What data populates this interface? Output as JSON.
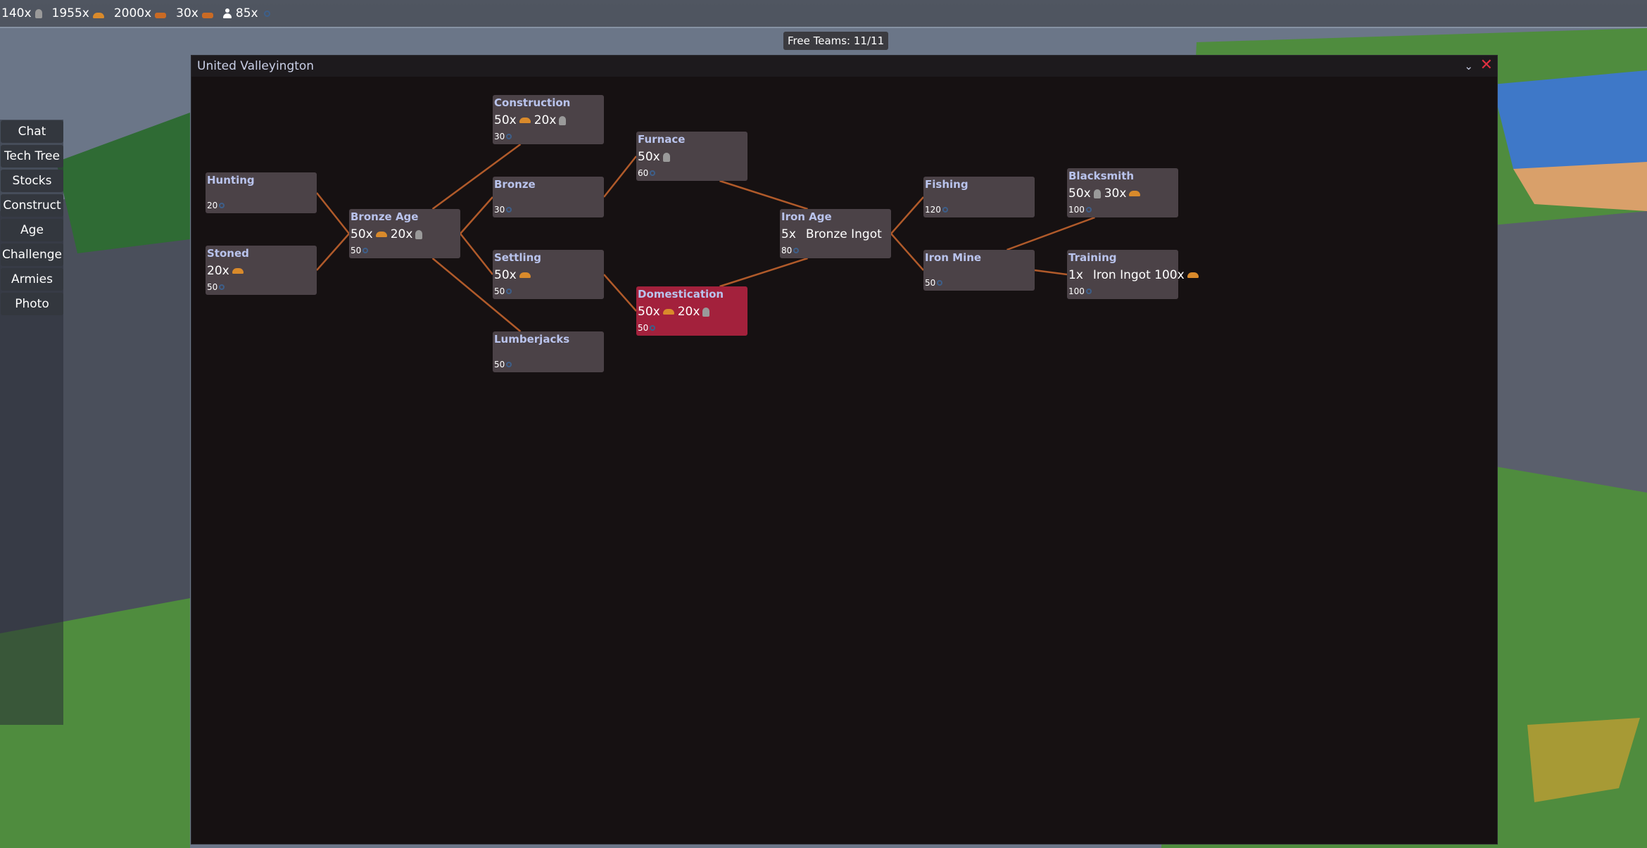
{
  "hud": {
    "resources": [
      {
        "amount": "140x",
        "icon": "stone-icon"
      },
      {
        "amount": "1955x",
        "icon": "food-icon"
      },
      {
        "amount": "2000x",
        "icon": "wood-icon"
      },
      {
        "amount": "30x",
        "icon": "wood-icon"
      },
      {
        "amount": "85x",
        "icon": "person-icon",
        "prefix_icon": true
      },
      {
        "amount": "",
        "icon": "gear-icon"
      }
    ],
    "free_teams": "Free Teams: 11/11"
  },
  "menu": {
    "items": [
      "Chat",
      "Tech Tree",
      "Stocks",
      "Construct",
      "Age",
      "Challenge",
      "Armies",
      "Photo"
    ]
  },
  "window": {
    "title": "United Valleyington",
    "minimize_icon": "chevron-down-icon",
    "close_icon": "close-icon"
  },
  "tech_tree": {
    "nodes": [
      {
        "id": "hunting",
        "name": "Hunting",
        "cost": [],
        "xp": "20"
      },
      {
        "id": "stoned",
        "name": "Stoned",
        "cost": [
          {
            "amount": "20x",
            "icon": "food-icon"
          }
        ],
        "xp": "50"
      },
      {
        "id": "bronze-age",
        "name": "Bronze Age",
        "cost": [
          {
            "amount": "50x",
            "icon": "food-icon"
          },
          {
            "amount": "20x",
            "icon": "stone-icon"
          }
        ],
        "xp": "50"
      },
      {
        "id": "construction",
        "name": "Construction",
        "cost": [
          {
            "amount": "50x",
            "icon": "food-icon"
          },
          {
            "amount": "20x",
            "icon": "stone-icon"
          }
        ],
        "xp": "30"
      },
      {
        "id": "bronze",
        "name": "Bronze",
        "cost": [],
        "xp": "30"
      },
      {
        "id": "settling",
        "name": "Settling",
        "cost": [
          {
            "amount": "50x",
            "icon": "food-icon"
          }
        ],
        "xp": "50"
      },
      {
        "id": "lumberjacks",
        "name": "Lumberjacks",
        "cost": [],
        "xp": "50"
      },
      {
        "id": "furnace",
        "name": "Furnace",
        "cost": [
          {
            "amount": "50x",
            "icon": "stone-icon"
          }
        ],
        "xp": "60"
      },
      {
        "id": "domestication",
        "name": "Domestication",
        "cost": [
          {
            "amount": "50x",
            "icon": "food-icon"
          },
          {
            "amount": "20x",
            "icon": "tree-icon"
          }
        ],
        "xp": "50",
        "active": true
      },
      {
        "id": "iron-age",
        "name": "Iron Age",
        "cost": [
          {
            "amount": "5x",
            "icon": ""
          },
          {
            "amount": "Bronze Ingot",
            "icon": ""
          }
        ],
        "xp": "80"
      },
      {
        "id": "fishing",
        "name": "Fishing",
        "cost": [],
        "xp": "120"
      },
      {
        "id": "iron-mine",
        "name": "Iron Mine",
        "cost": [],
        "xp": "50"
      },
      {
        "id": "blacksmith",
        "name": "Blacksmith",
        "cost": [
          {
            "amount": "50x",
            "icon": "stone-icon"
          },
          {
            "amount": "30x",
            "icon": "food-icon"
          }
        ],
        "xp": "100"
      },
      {
        "id": "training",
        "name": "Training",
        "cost": [
          {
            "amount": "1x",
            "icon": ""
          },
          {
            "amount": "Iron Ingot 100x",
            "icon": "food-icon"
          }
        ],
        "xp": "100"
      }
    ],
    "links": [
      [
        "hunting",
        "bronze-age"
      ],
      [
        "stoned",
        "bronze-age"
      ],
      [
        "bronze-age",
        "construction"
      ],
      [
        "bronze-age",
        "bronze"
      ],
      [
        "bronze-age",
        "settling"
      ],
      [
        "bronze-age",
        "lumberjacks"
      ],
      [
        "bronze",
        "furnace"
      ],
      [
        "settling",
        "domestication"
      ],
      [
        "furnace",
        "iron-age"
      ],
      [
        "domestication",
        "iron-age"
      ],
      [
        "iron-age",
        "fishing"
      ],
      [
        "iron-age",
        "iron-mine"
      ],
      [
        "iron-mine",
        "blacksmith"
      ],
      [
        "iron-mine",
        "training"
      ]
    ],
    "link_color": "#b05a2a",
    "active_color": "#a3213c"
  }
}
